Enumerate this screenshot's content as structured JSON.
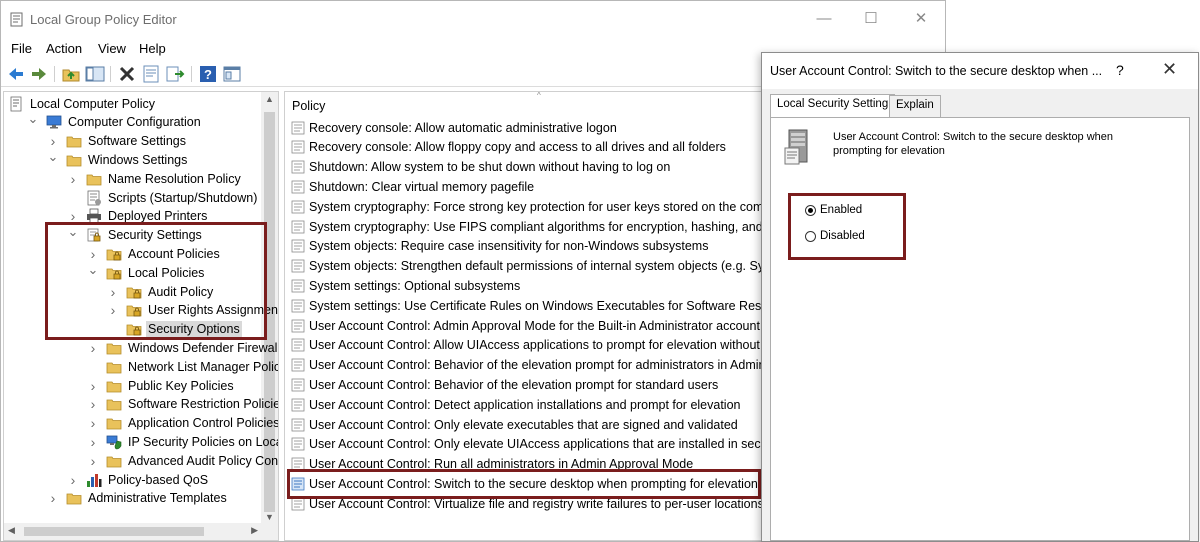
{
  "app": {
    "title": "Local Group Policy Editor",
    "window_controls": {
      "minimize": "—",
      "maximize": "☐",
      "close": "✕"
    }
  },
  "menu": [
    "File",
    "Action",
    "View",
    "Help"
  ],
  "toolbar": [
    "back-arrow-icon",
    "forward-arrow-icon",
    "up-folder-icon",
    "show-hide-tree-icon",
    "delete-icon",
    "properties-icon",
    "export-list-icon",
    "help-icon",
    "console-view-icon"
  ],
  "tree": {
    "items": [
      {
        "label": "Local Computer Policy",
        "icon": "computer-policy-icon",
        "expander": ""
      },
      {
        "label": "Computer Configuration",
        "icon": "computer-icon",
        "expander": "open"
      },
      {
        "label": "Software Settings",
        "icon": "folder-icon",
        "expander": "closed"
      },
      {
        "label": "Windows Settings",
        "icon": "folder-icon",
        "expander": "open"
      },
      {
        "label": "Name Resolution Policy",
        "icon": "folder-icon",
        "expander": "closed"
      },
      {
        "label": "Scripts (Startup/Shutdown)",
        "icon": "script-icon",
        "expander": ""
      },
      {
        "label": "Deployed Printers",
        "icon": "printer-icon",
        "expander": "closed"
      },
      {
        "label": "Security Settings",
        "icon": "security-folder-icon",
        "expander": "open"
      },
      {
        "label": "Account Policies",
        "icon": "locked-folder-icon",
        "expander": "closed"
      },
      {
        "label": "Local Policies",
        "icon": "locked-folder-icon",
        "expander": "open"
      },
      {
        "label": "Audit Policy",
        "icon": "locked-folder-icon",
        "expander": "closed"
      },
      {
        "label": "User Rights Assignment",
        "icon": "locked-folder-icon",
        "expander": "closed"
      },
      {
        "label": "Security Options",
        "icon": "locked-folder-icon",
        "expander": "",
        "selected": true
      },
      {
        "label": "Windows Defender Firewall w",
        "icon": "folder-icon",
        "expander": "closed"
      },
      {
        "label": "Network List Manager Policie",
        "icon": "folder-icon",
        "expander": ""
      },
      {
        "label": "Public Key Policies",
        "icon": "folder-icon",
        "expander": "closed"
      },
      {
        "label": "Software Restriction Policies",
        "icon": "folder-icon",
        "expander": "closed"
      },
      {
        "label": "Application Control Policies",
        "icon": "folder-icon",
        "expander": "closed"
      },
      {
        "label": "IP Security Policies on Local C",
        "icon": "ip-security-icon",
        "expander": "closed"
      },
      {
        "label": "Advanced Audit Policy Confi",
        "icon": "folder-icon",
        "expander": "closed"
      },
      {
        "label": "Policy-based QoS",
        "icon": "chart-icon",
        "expander": "closed"
      },
      {
        "label": "Administrative Templates",
        "icon": "folder-icon",
        "expander": "closed"
      }
    ]
  },
  "list": {
    "header": "Policy",
    "sort_caret": "^",
    "rows": [
      "Recovery console: Allow automatic administrative logon",
      "Recovery console: Allow floppy copy and access to all drives and all folders",
      "Shutdown: Allow system to be shut down without having to log on",
      "Shutdown: Clear virtual memory pagefile",
      "System cryptography: Force strong key protection for user keys stored on the compu",
      "System cryptography: Use FIPS compliant algorithms for encryption, hashing, and sig",
      "System objects: Require case insensitivity for non-Windows subsystems",
      "System objects: Strengthen default permissions of internal system objects (e.g. Symb",
      "System settings: Optional subsystems",
      "System settings: Use Certificate Rules on Windows Executables for Software Restrictio",
      "User Account Control: Admin Approval Mode for the Built-in Administrator account",
      "User Account Control: Allow UIAccess applications to prompt for elevation without us",
      "User Account Control: Behavior of the elevation prompt for administrators in Admin",
      "User Account Control: Behavior of the elevation prompt for standard users",
      "User Account Control: Detect application installations and prompt for elevation",
      "User Account Control: Only elevate executables that are signed and validated",
      "User Account Control: Only elevate UIAccess applications that are installed in secure",
      "User Account Control: Run all administrators in Admin Approval Mode",
      "User Account Control: Switch to the secure desktop when prompting for elevation",
      "User Account Control: Virtualize file and registry write failures to per-user locations"
    ],
    "selected_row": "User Account Control: Switch to the secure desktop when prompting for elevation"
  },
  "dialog": {
    "title": "User Account Control: Switch to the secure desktop when ...",
    "help": "?",
    "close": "✕",
    "tabs": [
      "Local Security Setting",
      "Explain"
    ],
    "active_tab": "Local Security Setting",
    "description_line1": "User Account Control: Switch to the secure desktop when",
    "description_line2": "prompting for elevation",
    "options": [
      {
        "label": "Enabled",
        "checked": true
      },
      {
        "label": "Disabled",
        "checked": false
      }
    ]
  },
  "colors": {
    "highlight_border": "#7a1d1d",
    "folder": "#e9c25b",
    "selection": "#d9d9d9"
  }
}
